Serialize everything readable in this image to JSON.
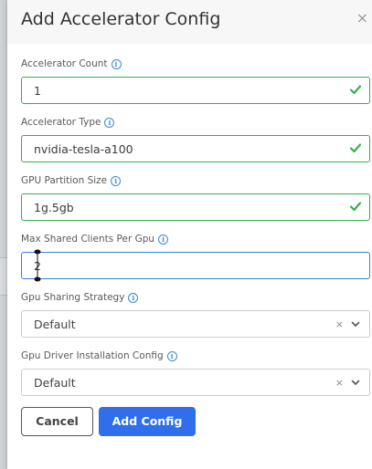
{
  "modal": {
    "title": "Add Accelerator Config",
    "close_glyph": "×"
  },
  "fields": {
    "accelerator_count": {
      "label": "Accelerator Count",
      "value": "1"
    },
    "accelerator_type": {
      "label": "Accelerator Type",
      "value": "nvidia-tesla-a100"
    },
    "gpu_partition_size": {
      "label": "GPU Partition Size",
      "value": "1g.5gb"
    },
    "max_shared_clients": {
      "label": "Max Shared Clients Per Gpu",
      "value": "2"
    },
    "gpu_sharing_strategy": {
      "label": "Gpu Sharing Strategy",
      "value": "Default"
    },
    "gpu_driver_installation": {
      "label": "Gpu Driver Installation Config",
      "value": "Default"
    }
  },
  "buttons": {
    "cancel": "Cancel",
    "add_config": "Add Config"
  },
  "icons": {
    "info": "i",
    "clear": "×",
    "check": "check-icon",
    "chevron": "chevron-down-icon"
  },
  "colors": {
    "valid_border": "#33b24c",
    "active_border": "#3b7ddd",
    "primary_button": "#2f6feb",
    "info_icon": "#3a86d6"
  }
}
